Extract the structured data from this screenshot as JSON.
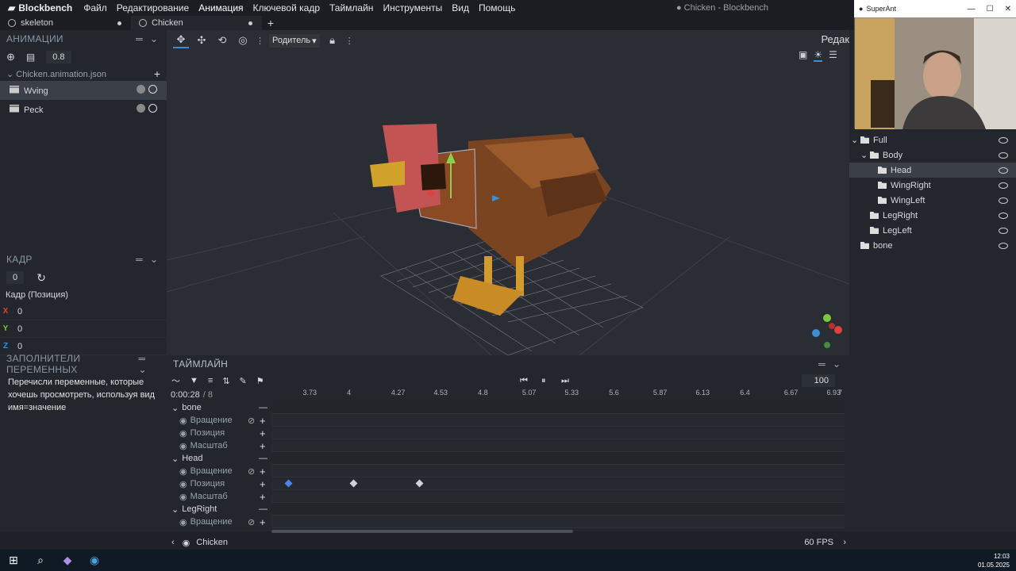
{
  "menubar": {
    "app_name": "Blockbench",
    "items": [
      "Файл",
      "Редактирование",
      "Анимация",
      "Ключевой кадр",
      "Таймлайн",
      "Инструменты",
      "Вид",
      "Помощь"
    ],
    "window_title": "● Chicken - Blockbench"
  },
  "tabs": [
    {
      "label": "skeleton"
    },
    {
      "label": "Chicken"
    }
  ],
  "animations": {
    "title": "АНИМАЦИИ",
    "speed": "0.8",
    "file": "Chicken.animation.json",
    "items": [
      {
        "label": "Wving",
        "selected": true
      },
      {
        "label": "Peck",
        "selected": false
      }
    ]
  },
  "keyframe": {
    "title": "КАДР",
    "value": "0",
    "channel_label": "Кадр (Позиция)",
    "axes": [
      {
        "axis": "X",
        "value": "0",
        "color": "#e0413c"
      },
      {
        "axis": "Y",
        "value": "0",
        "color": "#7ac83b"
      },
      {
        "axis": "Z",
        "value": "0",
        "color": "#3b8fd6"
      }
    ]
  },
  "variables": {
    "title": "ЗАПОЛНИТЕЛИ ПЕРЕМЕННЫХ",
    "text": "Перечисли переменные, которые хочешь просмотреть, используя вид имя=значение"
  },
  "viewport": {
    "pivot_label": "Родитель",
    "right_label": "Редак"
  },
  "camera": {
    "title": "SuperAnt"
  },
  "outliner": [
    {
      "label": "Full",
      "depth": 0,
      "expanded": true
    },
    {
      "label": "Body",
      "depth": 1,
      "expanded": true
    },
    {
      "label": "Head",
      "depth": 2,
      "selected": true
    },
    {
      "label": "WingRight",
      "depth": 2
    },
    {
      "label": "WingLeft",
      "depth": 2
    },
    {
      "label": "LegRight",
      "depth": 1
    },
    {
      "label": "LegLeft",
      "depth": 1
    },
    {
      "label": "bone",
      "depth": 0
    }
  ],
  "timeline": {
    "title": "ТАЙМЛАЙН",
    "time": "0:00:28",
    "length": "/ 8",
    "zoom": "100",
    "ruler": [
      "3.73",
      "4",
      "4.27",
      "4.53",
      "4.8",
      "5.07",
      "5.33",
      "5.6",
      "5.87",
      "6.13",
      "6.4",
      "6.67",
      "6.93",
      "7"
    ],
    "groups": [
      {
        "name": "bone",
        "channels": [
          "Вращение",
          "Позиция",
          "Масштаб"
        ]
      },
      {
        "name": "Head",
        "channels": [
          "Вращение",
          "Позиция",
          "Масштаб"
        ]
      },
      {
        "name": "LegRight",
        "channels": [
          "Вращение"
        ]
      }
    ],
    "keyframes": [
      {
        "group": "Head",
        "channel": "Позиция",
        "time": 3.6,
        "color": "#4a86e8"
      },
      {
        "group": "Head",
        "channel": "Позиция",
        "time": 4.0,
        "color": "#cfd2d6"
      },
      {
        "group": "Head",
        "channel": "Позиция",
        "time": 4.4,
        "color": "#cfd2d6"
      }
    ]
  },
  "statusbar": {
    "project": "Chicken",
    "fps": "60 FPS"
  },
  "taskbar": {
    "time": "12:03",
    "date": "01.05.2025"
  }
}
